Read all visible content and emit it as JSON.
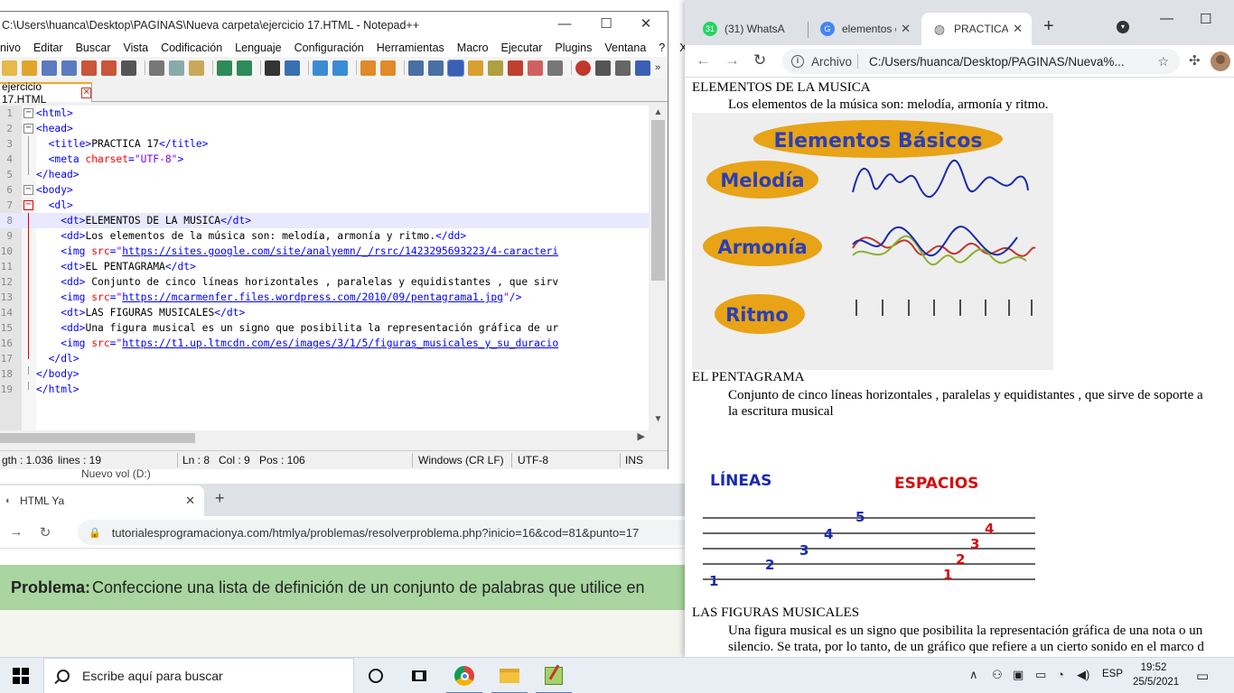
{
  "bg_browser": {
    "peek_text": "Nuevo vol (D:)",
    "tab_title": "HTML Ya",
    "url": "tutorialesprogramacionya.com/htmlya/problemas/resolverproblema.php?inicio=16&cod=81&punto=17",
    "problem_label": "Problema:",
    "problem_text": "Confeccione una lista de definición de un conjunto de palabras que utilice en"
  },
  "notepad": {
    "title": "C:\\Users\\huanca\\Desktop\\PAGINAS\\Nueva carpeta\\ejercicio 17.HTML - Notepad++",
    "menu": [
      "nivo",
      "Editar",
      "Buscar",
      "Vista",
      "Codificación",
      "Lenguaje",
      "Configuración",
      "Herramientas",
      "Macro",
      "Ejecutar",
      "Plugins",
      "Ventana",
      "?",
      "X"
    ],
    "tab_name": "ejercicio 17.HTML",
    "code": [
      {
        "n": "1",
        "fold": "minus",
        "tokens": [
          [
            "tg",
            "<html>"
          ]
        ]
      },
      {
        "n": "2",
        "fold": "minus",
        "tokens": [
          [
            "tg",
            "<head>"
          ]
        ]
      },
      {
        "n": "3",
        "fold": "line",
        "tokens": [
          [
            "tx",
            "  "
          ],
          [
            "tg",
            "<title>"
          ],
          [
            "tx",
            "PRACTICA 17"
          ],
          [
            "tg",
            "</title>"
          ]
        ]
      },
      {
        "n": "4",
        "fold": "line",
        "tokens": [
          [
            "tx",
            "  "
          ],
          [
            "tg",
            "<meta "
          ],
          [
            "at",
            "charset"
          ],
          [
            "tg",
            "="
          ],
          [
            "st",
            "\"UTF-8\""
          ],
          [
            "tg",
            ">"
          ]
        ]
      },
      {
        "n": "5",
        "fold": "end",
        "tokens": [
          [
            "tg",
            "</head>"
          ]
        ]
      },
      {
        "n": "6",
        "fold": "minus",
        "tokens": [
          [
            "tg",
            "<body>"
          ]
        ]
      },
      {
        "n": "7",
        "fold": "minus-red",
        "tokens": [
          [
            "tx",
            "  "
          ],
          [
            "tg",
            "<dl>"
          ]
        ]
      },
      {
        "n": "8",
        "fold": "line-red",
        "current": true,
        "tokens": [
          [
            "tx",
            "    "
          ],
          [
            "tg",
            "<dt>"
          ],
          [
            "tx",
            "ELEMENTOS DE LA MUSICA"
          ],
          [
            "tg",
            "</dt>"
          ]
        ]
      },
      {
        "n": "9",
        "fold": "line-red",
        "tokens": [
          [
            "tx",
            "    "
          ],
          [
            "tg",
            "<dd>"
          ],
          [
            "tx",
            "Los elementos de la música son: melodía, armonía y ritmo."
          ],
          [
            "tg",
            "</dd>"
          ]
        ]
      },
      {
        "n": "10",
        "fold": "line-red",
        "tokens": [
          [
            "tx",
            "    "
          ],
          [
            "tg",
            "<img "
          ],
          [
            "at",
            "src"
          ],
          [
            "tg",
            "="
          ],
          [
            "st",
            "\""
          ],
          [
            "lk",
            "https://sites.google.com/site/analyemn/_/rsrc/1423295693223/4-caracteri"
          ]
        ]
      },
      {
        "n": "11",
        "fold": "line-red",
        "tokens": [
          [
            "tx",
            "    "
          ],
          [
            "tg",
            "<dt>"
          ],
          [
            "tx",
            "EL PENTAGRAMA"
          ],
          [
            "tg",
            "</dt>"
          ]
        ]
      },
      {
        "n": "12",
        "fold": "line-red",
        "tokens": [
          [
            "tx",
            "    "
          ],
          [
            "tg",
            "<dd>"
          ],
          [
            "tx",
            " Conjunto de cinco líneas horizontales , paralelas y equidistantes , que sirv"
          ]
        ]
      },
      {
        "n": "13",
        "fold": "line-red",
        "tokens": [
          [
            "tx",
            "    "
          ],
          [
            "tg",
            "<img "
          ],
          [
            "at",
            "src"
          ],
          [
            "tg",
            "="
          ],
          [
            "st",
            "\""
          ],
          [
            "lk",
            "https://mcarmenfer.files.wordpress.com/2010/09/pentagrama1.jpg"
          ],
          [
            "st",
            "\""
          ],
          [
            "tg",
            "/>"
          ]
        ]
      },
      {
        "n": "14",
        "fold": "line-red",
        "tokens": [
          [
            "tx",
            "    "
          ],
          [
            "tg",
            "<dt>"
          ],
          [
            "tx",
            "LAS FIGURAS MUSICALES"
          ],
          [
            "tg",
            "</dt>"
          ]
        ]
      },
      {
        "n": "15",
        "fold": "line-red",
        "tokens": [
          [
            "tx",
            "    "
          ],
          [
            "tg",
            "<dd>"
          ],
          [
            "tx",
            "Una figura musical es un signo que posibilita la representación gráfica de ur"
          ]
        ]
      },
      {
        "n": "16",
        "fold": "line-red",
        "tokens": [
          [
            "tx",
            "    "
          ],
          [
            "tg",
            "<img "
          ],
          [
            "at",
            "src"
          ],
          [
            "tg",
            "="
          ],
          [
            "st",
            "\""
          ],
          [
            "lk",
            "https://t1.up.ltmcdn.com/es/images/3/1/5/figuras_musicales_y_su_duracio"
          ]
        ]
      },
      {
        "n": "17",
        "fold": "end-red",
        "tokens": [
          [
            "tx",
            "  "
          ],
          [
            "tg",
            "</dl>"
          ]
        ]
      },
      {
        "n": "18",
        "fold": "end",
        "tokens": [
          [
            "tg",
            "</body>"
          ]
        ]
      },
      {
        "n": "19",
        "fold": "end",
        "tokens": [
          [
            "tg",
            "</html>"
          ]
        ]
      }
    ],
    "status": {
      "length": "gth : 1.036",
      "lines": "lines : 19",
      "ln": "Ln : 8",
      "col": "Col : 9",
      "pos": "Pos : 106",
      "eol": "Windows (CR LF)",
      "encoding": "UTF-8",
      "mode": "INS"
    }
  },
  "chrome": {
    "tabs": [
      {
        "title": "(31) WhatsA",
        "icon": "whatsapp-icon",
        "badge": "31",
        "color": "#25d366"
      },
      {
        "title": "elementos d",
        "icon": "google-icon",
        "badge": "G",
        "color": "#4285f4"
      },
      {
        "title": "PRACTICA 1",
        "icon": "globe-icon",
        "badge": "",
        "color": "#5f6368"
      }
    ],
    "scheme": "Archivo",
    "url": "C:/Users/huanca/Desktop/PAGINAS/Nueva%...",
    "page": {
      "dt1": "ELEMENTOS DE LA MUSICA",
      "dd1": "Los elementos de la música son: melodía, armonía y ritmo.",
      "img1": {
        "title": "Elementos Básicos",
        "labels": [
          "Melodía",
          "Armonía",
          "Ritmo"
        ],
        "fill": "#e8a317",
        "text": "#2a3fb5"
      },
      "dt2": "EL PENTAGRAMA",
      "dd2_line1": "Conjunto de cinco líneas horizontales , paralelas y equidistantes , que sirve de soporte a",
      "dd2_line2": "la escritura musical",
      "img2": {
        "left_label": "LÍNEAS",
        "right_label": "ESPACIOS",
        "line_numbers": [
          "1",
          "2",
          "3",
          "4",
          "5"
        ],
        "space_numbers": [
          "1",
          "2",
          "3",
          "4"
        ],
        "blue": "#1a2ab0",
        "red": "#d40f0f"
      },
      "dt3": "LAS FIGURAS MUSICALES",
      "dd3_line1": "Una figura musical es un signo que posibilita la representación gráfica de una nota o un",
      "dd3_line2": "silencio. Se trata, por lo tanto, de un gráfico que refiere a un cierto sonido en el marco d"
    }
  },
  "taskbar": {
    "search_placeholder": "Escribe aquí para buscar",
    "lang": "ESP",
    "time": "19:52",
    "date": "25/5/2021"
  }
}
